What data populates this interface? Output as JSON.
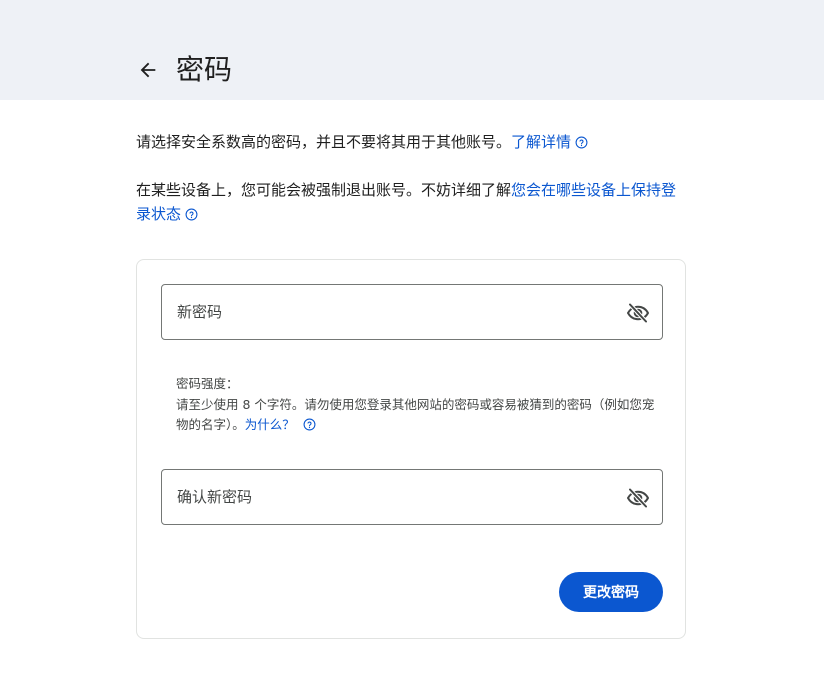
{
  "header": {
    "title": "密码",
    "back_icon": "arrow-back-icon",
    "background": "#eef1f6"
  },
  "intro": {
    "line1_text": "请选择安全系数高的密码，并且不要将其用于其他账号。",
    "line1_link": "了解详情",
    "line2_text": "在某些设备上，您可能会被强制退出账号。不妨详细了解",
    "line2_link": "您会在哪些设备上保持登录状态",
    "help_icon": "help-circle-icon"
  },
  "form": {
    "new_password": {
      "placeholder": "新密码",
      "value": "",
      "toggle_icon": "eye-off-icon"
    },
    "strength": {
      "title": "密码强度：",
      "description": "请至少使用 8 个字符。请勿使用您登录其他网站的密码或容易被猜到的密码（例如您宠物的名字）。",
      "link": "为什么？"
    },
    "confirm_password": {
      "placeholder": "确认新密码",
      "value": "",
      "toggle_icon": "eye-off-icon"
    },
    "submit_label": "更改密码"
  },
  "colors": {
    "accent": "#0b57d0",
    "text": "#1f1f1f",
    "secondary_text": "#444746",
    "border": "#747775"
  }
}
